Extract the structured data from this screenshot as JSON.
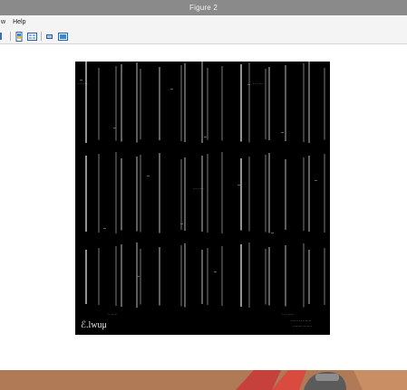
{
  "window": {
    "title": "Figure 2"
  },
  "menu": {
    "items": [
      "w",
      "Help"
    ]
  },
  "toolbar": {
    "icons": [
      "zoom-icon",
      "insert-colorbar-icon",
      "insert-legend-icon",
      "hide-plot-tools-icon",
      "show-plot-tools-icon"
    ]
  },
  "image": {
    "description_visible_text": {
      "tl": "··· ·····",
      "tr": "··· ·····",
      "center": "··· ·····",
      "bl_small": "·· ·····",
      "br_small": "··· ······",
      "bl_logo": "ℰ.lwuμ",
      "br_line1": "······ ·· ·······",
      "br_line2": "········ ·······"
    }
  },
  "colors": {
    "titlebar": "#8a8a8a",
    "plot_bg": "#000000",
    "taskbar": "#b07a57"
  }
}
